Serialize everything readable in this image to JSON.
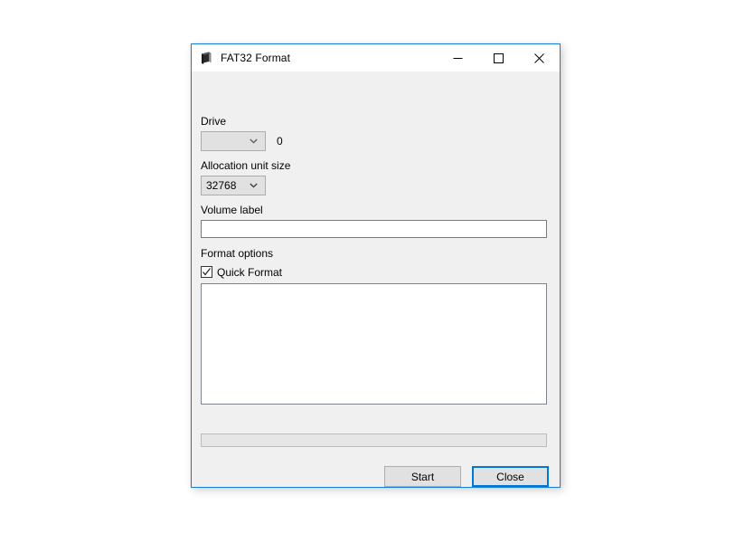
{
  "window": {
    "title": "FAT32 Format",
    "icon": "disk-format-icon",
    "border_color": "#1a7fd4",
    "titlebar_bg": "#ffffff",
    "client_bg": "#f0f0f0",
    "controls": {
      "minimize": "minimize-icon",
      "maximize": "maximize-icon",
      "close": "close-icon"
    }
  },
  "form": {
    "drive": {
      "label": "Drive",
      "selected": "",
      "size_text": "0"
    },
    "allocation_unit_size": {
      "label": "Allocation unit size",
      "selected": "32768"
    },
    "volume_label": {
      "label": "Volume label",
      "value": "",
      "placeholder": ""
    },
    "format_options": {
      "label": "Format options",
      "quick_format": {
        "label": "Quick Format",
        "checked": true
      }
    }
  },
  "log": {
    "text": ""
  },
  "progress": {
    "percent": 0
  },
  "buttons": {
    "start": "Start",
    "close": "Close",
    "focused": "close"
  }
}
